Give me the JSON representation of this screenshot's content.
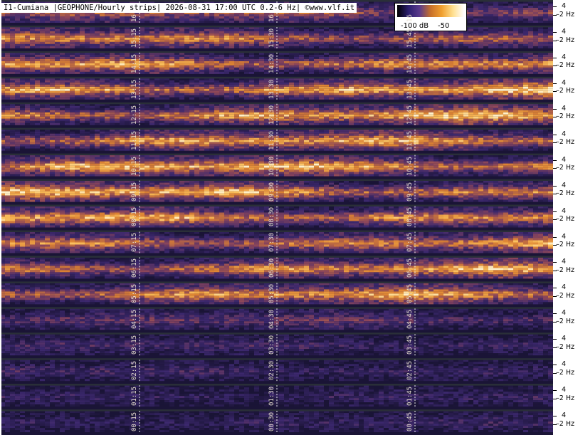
{
  "header": {
    "title": "I1-Cumiana |GEOPHONE/Hourly strips| 2026-08-31 17:00 UTC 0.2-6 Hz| ©www.vlf.it"
  },
  "legend": {
    "low_label": "-100 dB",
    "high_label": "-50",
    "colors": [
      "#000000",
      "#2b1e6e",
      "#5a3a8c",
      "#c8702a",
      "#f0a030",
      "#ffe090",
      "#ffffff"
    ]
  },
  "chart_data": {
    "type": "heatmap",
    "title": "I1-Cumiana |GEOPHONE/Hourly strips| 2026-08-31 17:00 UTC 0.2-6 Hz| ©www.vlf.it",
    "colorbar": {
      "min": -100,
      "max": -50,
      "unit": "dB",
      "labels": [
        "-100 dB",
        "-50"
      ]
    },
    "y_ticks": [
      "4",
      "2 Hz"
    ],
    "frequency_range_hz": [
      0.2,
      6
    ],
    "strips": [
      {
        "hour": "16",
        "intensity": 0.5,
        "time_labels": [
          "16",
          "16",
          "16"
        ]
      },
      {
        "hour": "15",
        "intensity": 0.65,
        "time_labels": [
          "15:15",
          "15:30",
          "15:45"
        ]
      },
      {
        "hour": "14",
        "intensity": 0.75,
        "time_labels": [
          "14:15",
          "14:30",
          "14:45"
        ]
      },
      {
        "hour": "13",
        "intensity": 0.8,
        "time_labels": [
          "13:15",
          "13:30",
          "13:45"
        ]
      },
      {
        "hour": "12",
        "intensity": 0.75,
        "time_labels": [
          "12:15",
          "12:30",
          "12:45"
        ]
      },
      {
        "hour": "11",
        "intensity": 0.7,
        "time_labels": [
          "11:15",
          "11:30",
          "11:45"
        ]
      },
      {
        "hour": "10",
        "intensity": 0.75,
        "time_labels": [
          "10:15",
          "10:30",
          "10:45"
        ]
      },
      {
        "hour": "09",
        "intensity": 0.75,
        "time_labels": [
          "09:15",
          "09:30",
          "09:45"
        ]
      },
      {
        "hour": "08",
        "intensity": 0.75,
        "time_labels": [
          "08:15",
          "08:30",
          "08:45"
        ]
      },
      {
        "hour": "07",
        "intensity": 0.7,
        "time_labels": [
          "07:15",
          "07:30",
          "07:45"
        ]
      },
      {
        "hour": "06",
        "intensity": 0.7,
        "time_labels": [
          "06:15",
          "06:30",
          "06:45"
        ]
      },
      {
        "hour": "05",
        "intensity": 0.7,
        "time_labels": [
          "05:15",
          "05:30",
          "05:45"
        ]
      },
      {
        "hour": "04",
        "intensity": 0.35,
        "time_labels": [
          "04:15",
          "04:30",
          "04:45"
        ]
      },
      {
        "hour": "03",
        "intensity": 0.25,
        "time_labels": [
          "03:15",
          "03:30",
          "03:45"
        ]
      },
      {
        "hour": "02",
        "intensity": 0.25,
        "time_labels": [
          "02:15",
          "02:30",
          "02:45"
        ]
      },
      {
        "hour": "01",
        "intensity": 0.22,
        "time_labels": [
          "01:15",
          "01:30",
          "01:45"
        ]
      },
      {
        "hour": "00",
        "intensity": 0.2,
        "time_labels": [
          "00:15",
          "00:30",
          "00:45"
        ]
      }
    ]
  }
}
